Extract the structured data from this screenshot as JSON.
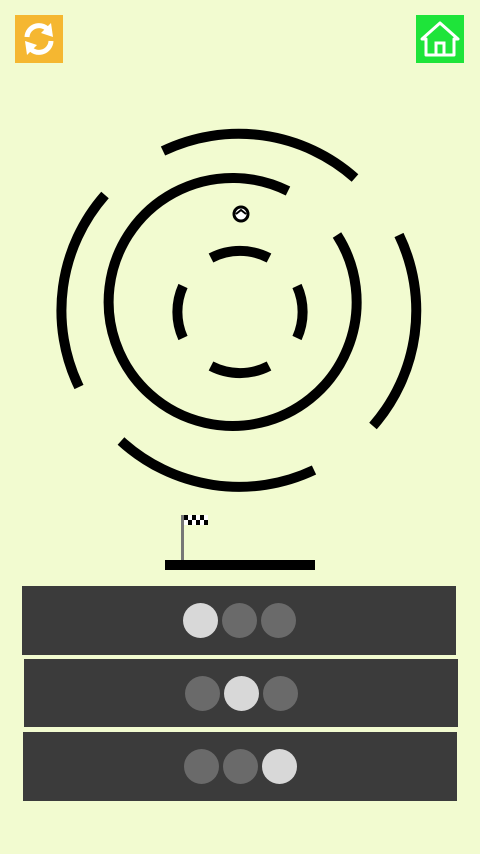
{
  "header": {
    "restart_icon": "refresh-icon",
    "home_icon": "home-icon",
    "restart_color": "#f5b731",
    "home_color": "#1ee43a"
  },
  "game": {
    "panels": [
      {
        "active_dot": 1,
        "dot_count": 3
      },
      {
        "active_dot": 2,
        "dot_count": 3
      },
      {
        "active_dot": 3,
        "dot_count": 3
      }
    ],
    "colors": {
      "background": "#f2fbd0",
      "ring": "#000000",
      "panel": "#3b3b3b",
      "dot_inactive": "#6a6a6a",
      "dot_active": "#d8d8d8"
    }
  }
}
